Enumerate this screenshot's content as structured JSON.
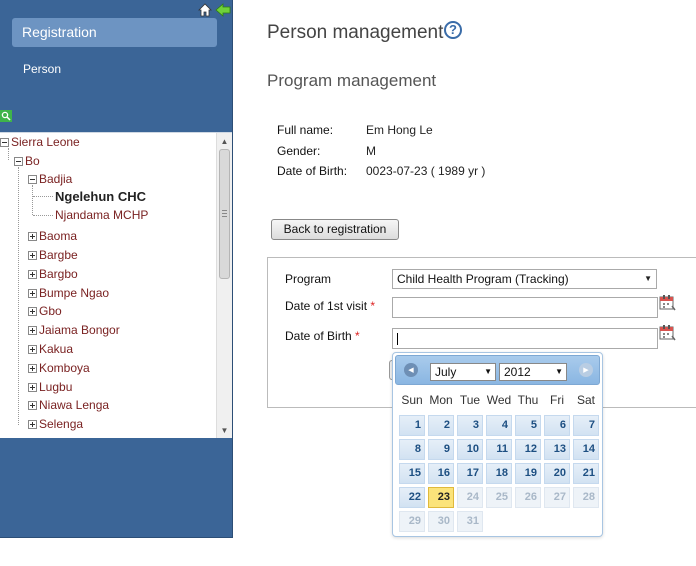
{
  "sidebar": {
    "active_menu": "Registration",
    "submenu": "Person"
  },
  "tree": {
    "nodes": [
      {
        "label": "Sierra Leone"
      },
      {
        "label": "Bo"
      },
      {
        "label": "Badjia"
      },
      {
        "label": "Ngelehun CHC"
      },
      {
        "label": "Njandama MCHP"
      },
      {
        "label": "Baoma"
      },
      {
        "label": "Bargbe"
      },
      {
        "label": "Bargbo"
      },
      {
        "label": "Bumpe Ngao"
      },
      {
        "label": "Gbo"
      },
      {
        "label": "Jaiama Bongor"
      },
      {
        "label": "Kakua"
      },
      {
        "label": "Komboya"
      },
      {
        "label": "Lugbu"
      },
      {
        "label": "Niawa Lenga"
      },
      {
        "label": "Selenga"
      }
    ]
  },
  "main": {
    "title": "Person management",
    "subtitle": "Program management",
    "person": {
      "name_label": "Full name:",
      "name_value": "Em Hong Le",
      "gender_label": "Gender:",
      "gender_value": "M",
      "dob_label": "Date of Birth:",
      "dob_value": "0023-07-23 ( 1989 yr )"
    },
    "back_button": "Back to registration",
    "form": {
      "program_label": "Program",
      "program_value": "Child Health Program (Tracking)",
      "first_visit_label": "Date of 1st visit",
      "dob_label": "Date of Birth",
      "required_mark": "*"
    }
  },
  "datepicker": {
    "month": "July",
    "year": "2012",
    "weekdays": [
      "Sun",
      "Mon",
      "Tue",
      "Wed",
      "Thu",
      "Fri",
      "Sat"
    ],
    "weeks": [
      [
        "1",
        "2",
        "3",
        "4",
        "5",
        "6",
        "7"
      ],
      [
        "8",
        "9",
        "10",
        "11",
        "12",
        "13",
        "14"
      ],
      [
        "15",
        "16",
        "17",
        "18",
        "19",
        "20",
        "21"
      ],
      [
        "22",
        "23",
        "24",
        "25",
        "26",
        "27",
        "28"
      ],
      [
        "29",
        "30",
        "31"
      ]
    ],
    "today": "23",
    "enabled_through": 23
  },
  "colors": {
    "sidebar_bg": "#3b6597",
    "active_menu_bg": "#6d94c2",
    "tree_link": "#7a2222",
    "today_bg": "#fbe37a"
  }
}
